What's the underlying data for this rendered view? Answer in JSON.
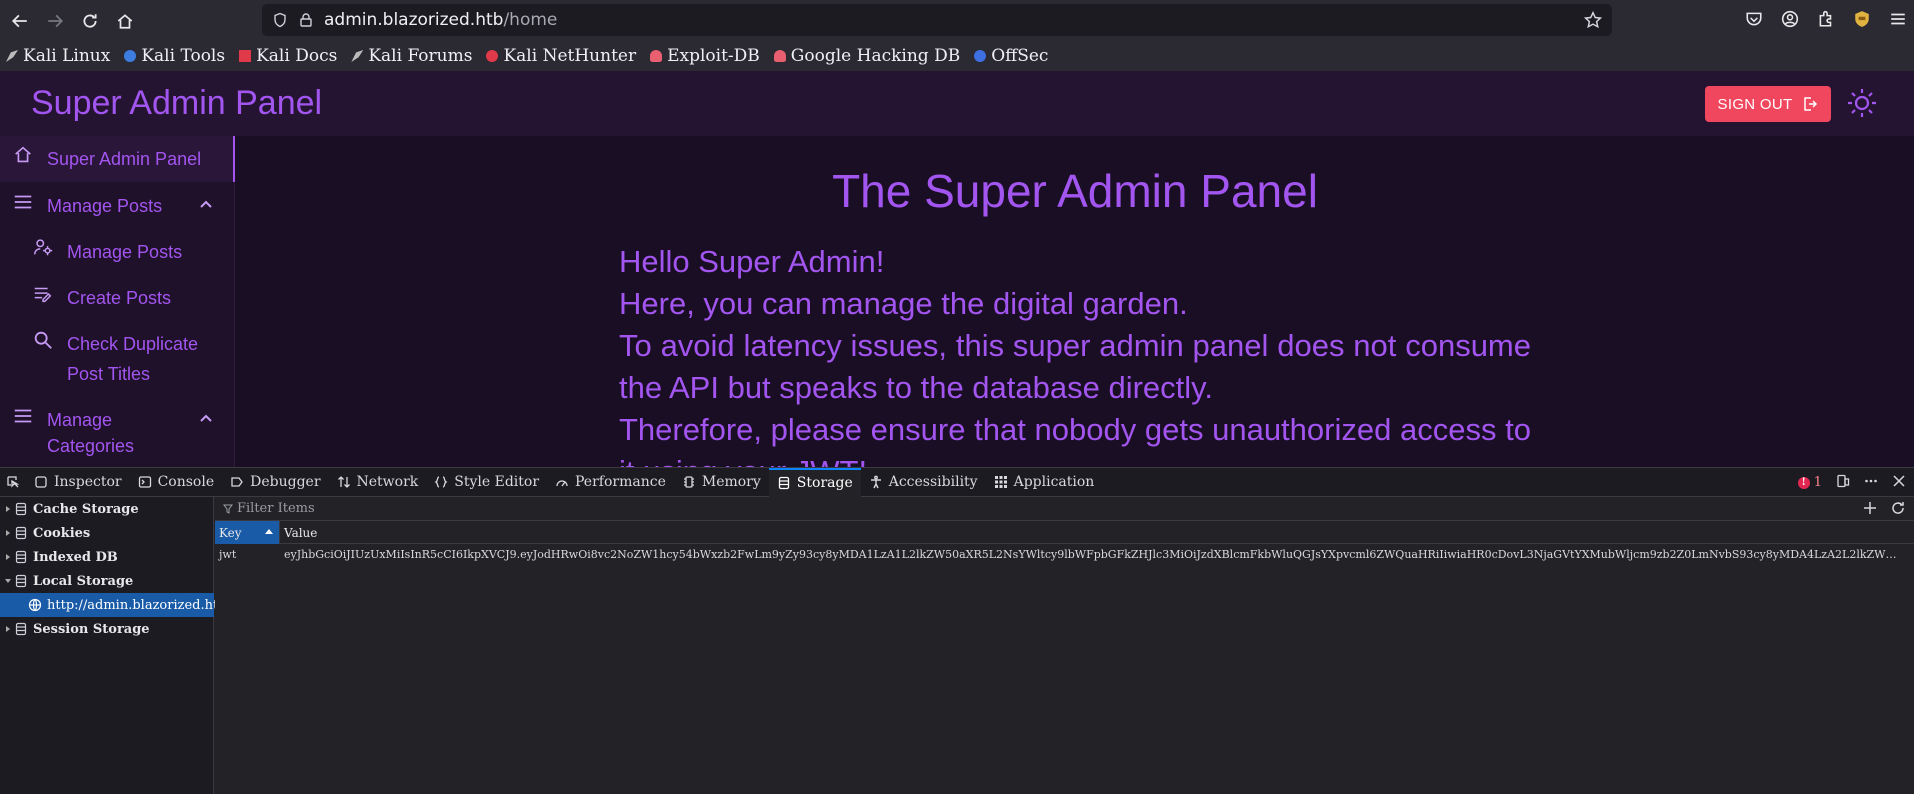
{
  "browser": {
    "url_host": "admin.blazorized.htb",
    "url_path": "/home",
    "bookmarks": [
      "Kali Linux",
      "Kali Tools",
      "Kali Docs",
      "Kali Forums",
      "Kali NetHunter",
      "Exploit-DB",
      "Google Hacking DB",
      "OffSec"
    ]
  },
  "app": {
    "brand": "Super Admin Panel",
    "signout_label": "SIGN OUT",
    "sidebar": [
      {
        "label": "Super Admin Panel",
        "icon": "home-icon"
      },
      {
        "label": "Manage Posts",
        "icon": "menu-icon"
      },
      {
        "label": "Manage Posts",
        "icon": "user-gear-icon"
      },
      {
        "label": "Create Posts",
        "icon": "edit-list-icon"
      },
      {
        "label": "Check Duplicate",
        "label2": "Post Titles",
        "icon": "search-icon"
      },
      {
        "label": "Manage",
        "label2": "Categories",
        "icon": "menu-icon"
      }
    ],
    "main_title": "The Super Admin Panel",
    "paragraph": [
      "Hello Super Admin!",
      "Here, you can manage the digital garden.",
      "To avoid latency issues, this super admin panel does not consume the API but speaks to the database directly.",
      "Therefore, please ensure that nobody gets unauthorized access to it using your JWT!"
    ]
  },
  "devtools": {
    "tabs": [
      "Inspector",
      "Console",
      "Debugger",
      "Network",
      "Style Editor",
      "Performance",
      "Memory",
      "Storage",
      "Accessibility",
      "Application"
    ],
    "selected_tab": "Storage",
    "error_count": "1",
    "tree": [
      "Cache Storage",
      "Cookies",
      "Indexed DB",
      "Local Storage",
      "http://admin.blazorized.htb",
      "Session Storage"
    ],
    "filter_placeholder": "Filter Items",
    "columns": {
      "key": "Key",
      "value": "Value"
    },
    "rows": [
      {
        "key": "jwt",
        "value": "eyJhbGciOiJIUzUxMiIsInR5cCI6IkpXVCJ9.eyJodHRwOi8vc2NoZW1hcy54bWxzb2FwLm9yZy93cy8yMDA1LzA1L2lkZW50aXR5L2NsYWltcy9lbWFpbGFkZHJlc3MiOiJzdXBlcmFkbWluQGJsYXpvcml6ZWQuaHRiIiwiaHR0cDovL3NjaGVtYXMubWljcm9zb2Z0LmNvbS93cy8yMDA4LzA2L2lkZW5..."
      }
    ]
  }
}
